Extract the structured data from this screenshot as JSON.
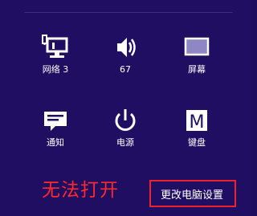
{
  "tiles": {
    "network": {
      "icon": "network-icon",
      "label": "网络 3"
    },
    "volume": {
      "icon": "speaker-icon",
      "label": "67"
    },
    "screen": {
      "icon": "screen-brightness-icon",
      "label": "屏幕"
    },
    "notifications": {
      "icon": "notifications-icon",
      "label": "通知"
    },
    "power": {
      "icon": "power-icon",
      "label": "电源"
    },
    "keyboard": {
      "icon": "keyboard-icon",
      "label": "键盘",
      "glyph": "M"
    }
  },
  "annotation": {
    "text": "无法打开",
    "color": "#ff2a2a"
  },
  "footer": {
    "change_settings_label": "更改电脑设置"
  },
  "colors": {
    "background": "#200e62",
    "highlight_border": "#e8242c",
    "foreground": "#ffffff"
  }
}
